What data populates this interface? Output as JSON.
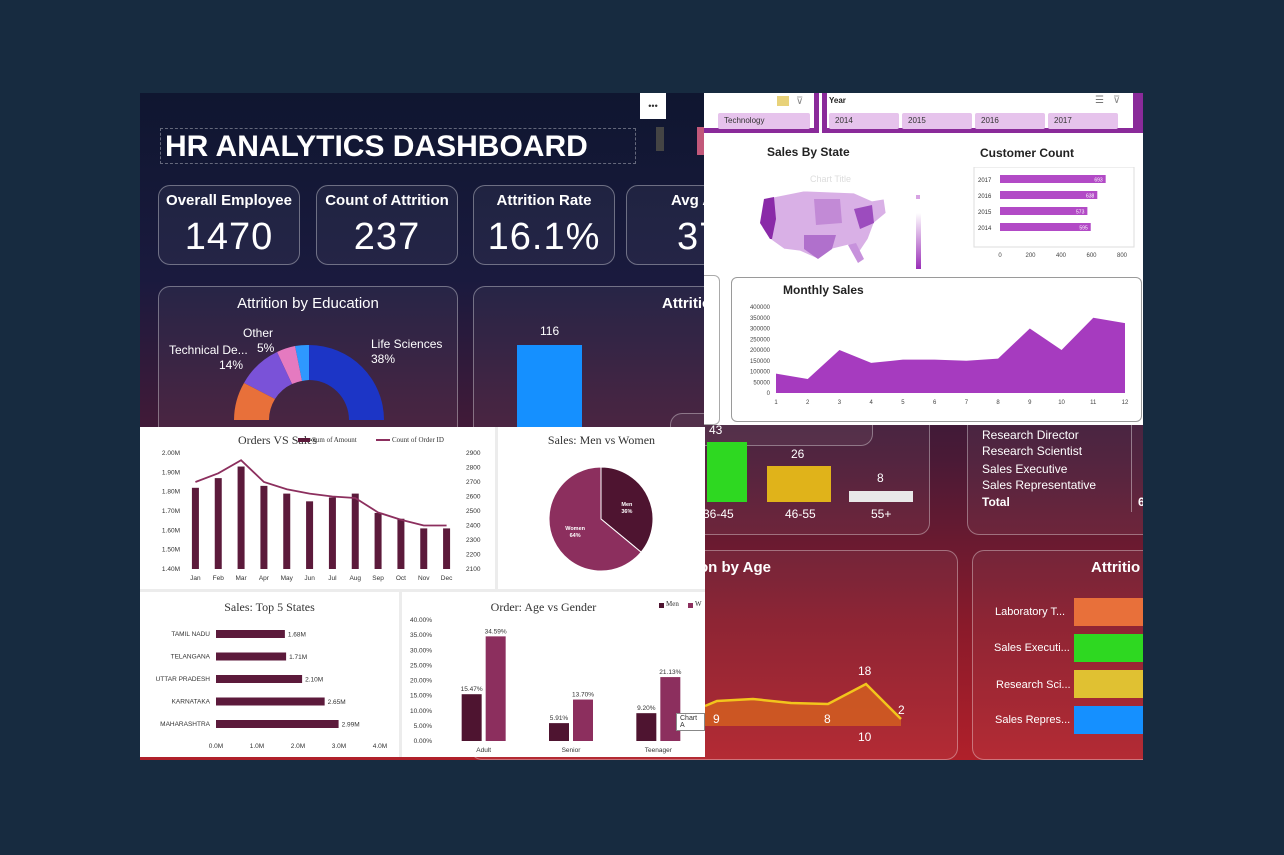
{
  "hr": {
    "title": "HR ANALYTICS DASHBOARD",
    "more_icon_glyph": "•••",
    "kpis": [
      {
        "label": "Overall Employee",
        "value": "1470"
      },
      {
        "label": "Count of Attrition",
        "value": "237"
      },
      {
        "label": "Attrition Rate",
        "value": "16.1%"
      },
      {
        "label": "Avg A",
        "value": "37"
      }
    ],
    "education": {
      "title": "Attrition by Education",
      "slices": [
        {
          "label": "Technical De...",
          "pct": "14%"
        },
        {
          "label": "Other",
          "pct": "5%"
        },
        {
          "label": "Life Sciences",
          "pct": "38%"
        }
      ]
    },
    "second_panel_title": "Attritio",
    "bar_value": "116",
    "age_bands": {
      "values": [
        "43",
        "26",
        "8"
      ],
      "labels": [
        "36-45",
        "46-55",
        "55+"
      ]
    },
    "job_roles": {
      "items": [
        "Research Director",
        "Research Scientist",
        "Sales Executive",
        "Sales Representative"
      ],
      "total_label": "Total",
      "total_value": "6"
    },
    "age_line": {
      "title": "on by Age",
      "labels": [
        "9",
        "8",
        "18",
        "10",
        "2"
      ]
    },
    "attrition_right": {
      "title": "Attritio",
      "rows": [
        "Laboratory T...",
        "Sales Executi...",
        "Research Sci...",
        "Sales Repres..."
      ],
      "colors": [
        "#e8703a",
        "#2ed821",
        "#e0c132",
        "#1590ff"
      ]
    }
  },
  "sales": {
    "slicer_chip": "Technology",
    "year_title": "Year",
    "years": [
      "2014",
      "2015",
      "2016",
      "2017"
    ],
    "state_title": "Sales By State",
    "state_chart_title": "Chart Title",
    "customer_title": "Customer Count",
    "customer_chart": {
      "type": "bar",
      "categories": [
        "2017",
        "2016",
        "2015",
        "2014"
      ],
      "values": [
        693,
        638,
        573,
        595
      ],
      "xticks": [
        "0",
        "200",
        "400",
        "600",
        "800"
      ],
      "xlim": [
        0,
        800
      ]
    },
    "monthly_title": "Monthly Sales",
    "monthly_chart": {
      "type": "area",
      "x": [
        1,
        2,
        3,
        4,
        5,
        6,
        7,
        8,
        9,
        10,
        11,
        12
      ],
      "values": [
        90000,
        65000,
        200000,
        140000,
        155000,
        155000,
        150000,
        160000,
        300000,
        200000,
        350000,
        325000
      ],
      "yticks": [
        "0",
        "50000",
        "100000",
        "150000",
        "200000",
        "250000",
        "300000",
        "350000",
        "400000"
      ],
      "ylim": [
        0,
        400000
      ],
      "color": "#a63bbf"
    }
  },
  "orders": {
    "orders_vs_sales": {
      "title": "Orders VS Sales",
      "legend": [
        "Sum of Amount",
        "Count of Order ID"
      ],
      "months": [
        "Jan",
        "Feb",
        "Mar",
        "Apr",
        "May",
        "Jun",
        "Jul",
        "Aug",
        "Sep",
        "Oct",
        "Nov",
        "Dec"
      ],
      "amount_millions": [
        1.82,
        1.87,
        1.93,
        1.83,
        1.79,
        1.75,
        1.77,
        1.79,
        1.69,
        1.66,
        1.61,
        1.61
      ],
      "order_counts": [
        2700,
        2760,
        2850,
        2700,
        2650,
        2620,
        2600,
        2590,
        2490,
        2440,
        2400,
        2400
      ],
      "left_ticks": [
        "2.00M",
        "1.90M",
        "1.80M",
        "1.70M",
        "1.60M",
        "1.50M",
        "1.40M"
      ],
      "right_ticks": [
        "2900",
        "2800",
        "2700",
        "2600",
        "2500",
        "2400",
        "2300",
        "2200",
        "2100"
      ],
      "color": "#5c1a3b"
    },
    "men_women": {
      "title": "Sales: Men vs Women",
      "slices": [
        {
          "label": "Men",
          "pct": "36%",
          "value": 36,
          "color": "#4e1430"
        },
        {
          "label": "Women",
          "pct": "64%",
          "value": 64,
          "color": "#8c2f5e"
        }
      ]
    },
    "top_states": {
      "title": "Sales: Top 5 States",
      "chart_data": {
        "type": "bar",
        "categories": [
          "TAMIL NADU",
          "TELANGANA",
          "UTTAR PRADESH",
          "KARNATAKA",
          "MAHARASHTRA"
        ],
        "values": [
          1.68,
          1.71,
          2.1,
          2.65,
          2.99
        ],
        "labels": [
          "1.68M",
          "1.71M",
          "2.10M",
          "2.65M",
          "2.99M"
        ],
        "xticks": [
          "0.0M",
          "1.0M",
          "2.0M",
          "3.0M",
          "4.0M"
        ],
        "xlim": [
          0,
          4
        ]
      }
    },
    "age_gender": {
      "title": "Order: Age vs Gender",
      "legend": [
        "Men",
        "W"
      ],
      "categories": [
        "Adult",
        "Senior",
        "Teenager"
      ],
      "men": [
        15.47,
        5.91,
        9.2
      ],
      "women": [
        34.59,
        13.7,
        21.13
      ],
      "men_labels": [
        "15.47%",
        "5.91%",
        "9.20%"
      ],
      "women_labels": [
        "34.59%",
        "13.70%",
        "21.13%"
      ],
      "yticks": [
        "40.00%",
        "35.00%",
        "30.00%",
        "25.00%",
        "20.00%",
        "15.00%",
        "10.00%",
        "5.00%",
        "0.00%"
      ],
      "ylim": [
        0,
        40
      ],
      "tooltip": "Chart A",
      "colors": [
        "#4e1430",
        "#8c2f5e"
      ]
    }
  }
}
